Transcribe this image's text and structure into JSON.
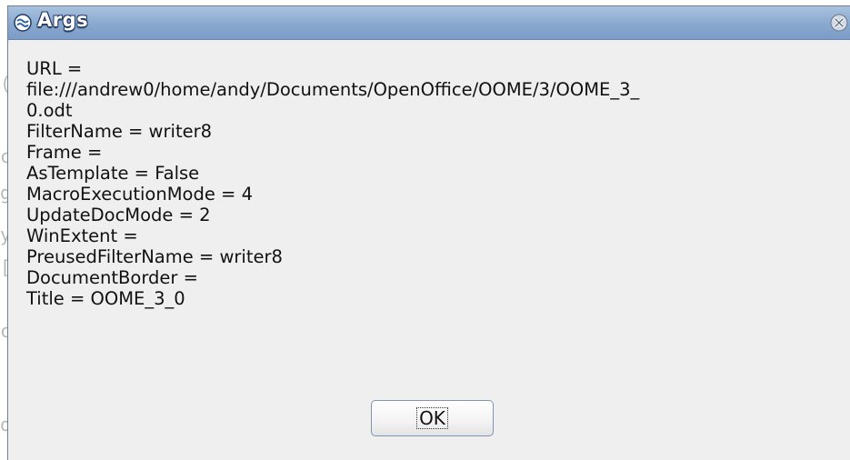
{
  "window": {
    "title": "Args",
    "icon": "openoffice-gull-icon",
    "close_icon": "close-icon"
  },
  "message_lines": [
    "URL =",
    "file:///andrew0/home/andy/Documents/OpenOffice/OOME/3/OOME_3_",
    "0.odt",
    "FilterName = writer8",
    "Frame =",
    "AsTemplate = False",
    "MacroExecutionMode = 4",
    "UpdateDocMode = 2",
    "WinExtent =",
    "PreusedFilterName = writer8",
    "DocumentBorder =",
    "Title = OOME_3_0"
  ],
  "buttons": {
    "ok_label": "OK"
  },
  "colors": {
    "titlebar": "#89a8cf",
    "dialog_bg": "#efefef",
    "title_text": "#ffffff"
  }
}
